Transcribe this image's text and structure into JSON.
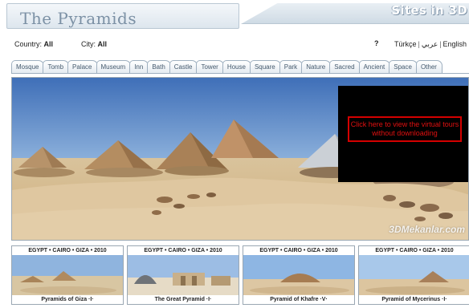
{
  "header": {
    "title": "The Pyramids",
    "sites_label": "Sites in 3D"
  },
  "filters": {
    "country_label": "Country:",
    "country_value": "All",
    "city_label": "City:",
    "city_value": "All"
  },
  "help_label": "?",
  "languages": [
    "Türkçe",
    "عربي",
    "English"
  ],
  "tabs": [
    "Mosque",
    "Tomb",
    "Palace",
    "Museum",
    "Inn",
    "Bath",
    "Castle",
    "Tower",
    "House",
    "Square",
    "Park",
    "Nature",
    "Sacred",
    "Ancient",
    "Space",
    "Other"
  ],
  "virtual_tour": {
    "button_text": "Click here to view the virtual tours without downloading"
  },
  "watermark": "3DMekanlar.com",
  "thumbnails": [
    {
      "caption": "EGYPT • CAIRO • GIZA • 2010",
      "name": "Pyramids of Giza  ·I·"
    },
    {
      "caption": "EGYPT • CAIRO • GIZA • 2010",
      "name": "The Great Pyramid  ·I·"
    },
    {
      "caption": "EGYPT • CAIRO • GIZA • 2010",
      "name": "Pyramid of Khafre  ·V·"
    },
    {
      "caption": "EGYPT • CAIRO • GIZA • 2010",
      "name": "Pyramid of Mycerinus  ·I·"
    }
  ],
  "colors": {
    "accent": "#7c91a5",
    "tab_text": "#455a6d",
    "virtual_tour_border": "#d40000",
    "virtual_tour_text": "#e01010",
    "panel_bg": "#000000"
  }
}
